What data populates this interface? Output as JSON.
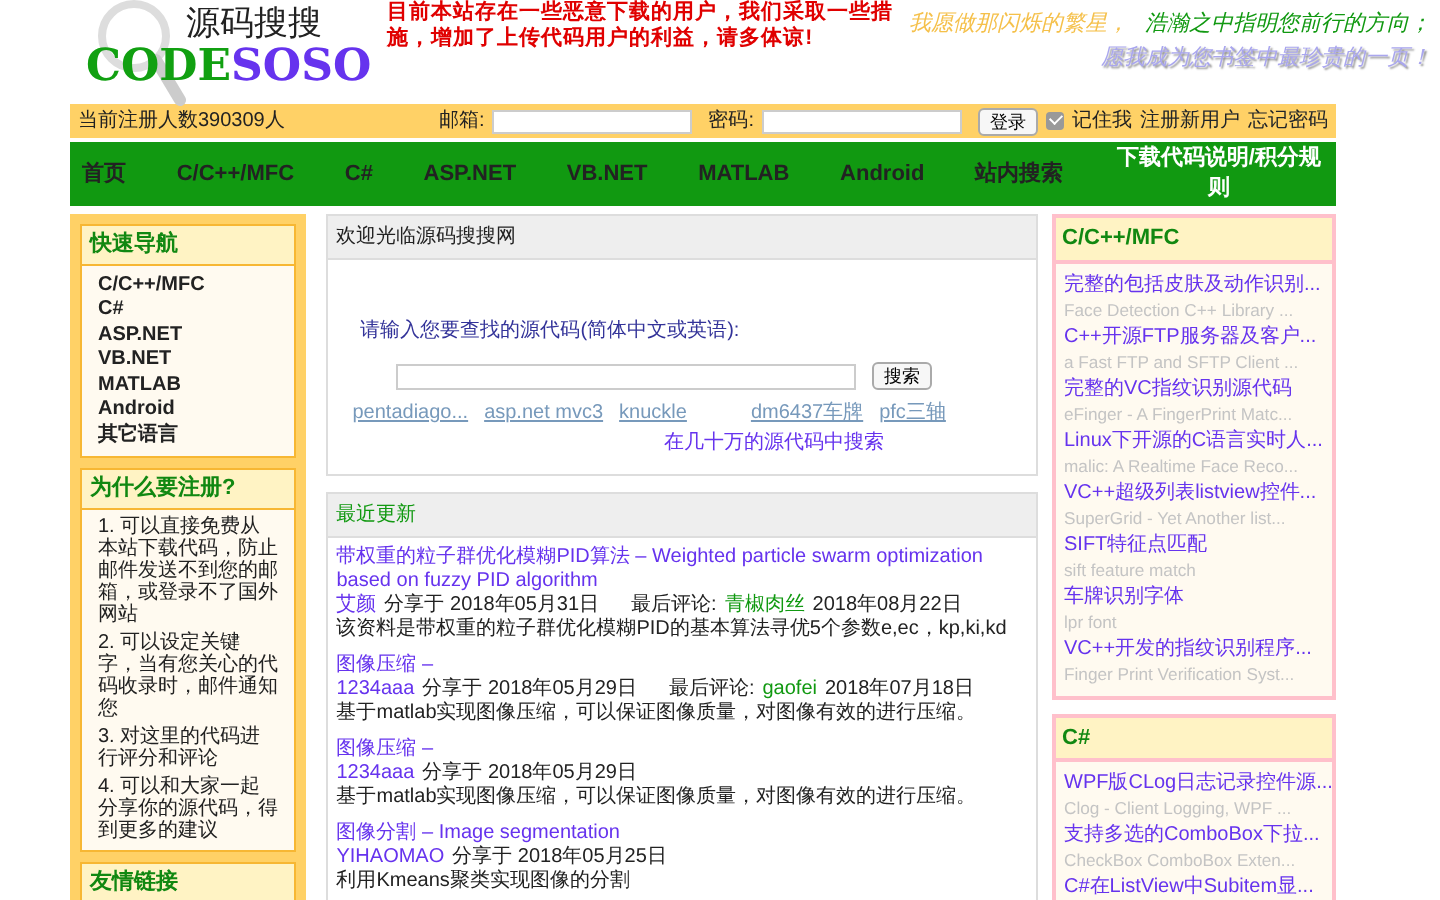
{
  "logo": {
    "chinese": "源码搜搜",
    "english_first": "CODE",
    "english_second": "SOSO"
  },
  "notice": "目前本站存在一些恶意下载的用户，我们采取一些措施，增加了上传代码用户的利益，请多体谅!",
  "slogans": [
    "我愿做那闪烁的繁星，",
    "浩瀚之中指明您前行的方向；",
    "愿我成为您书签中最珍贵的一页！"
  ],
  "login_bar": {
    "member_count": "当前注册人数390309人",
    "email_label": "邮箱:",
    "password_label": "密码:",
    "login_button": "登录",
    "remember": {
      "label": "记住我",
      "checked": true
    },
    "links": [
      "注册新用户",
      "忘记密码"
    ]
  },
  "nav": [
    "首页",
    "C/C++/MFC",
    "C#",
    "ASP.NET",
    "VB.NET",
    "MATLAB",
    "Android",
    "站内搜索",
    "下载代码说明/积分规则"
  ],
  "left_sidebar": {
    "quick_nav": {
      "title": "快速导航",
      "items": [
        "C/C++/MFC",
        "C#",
        "ASP.NET",
        "VB.NET",
        "MATLAB",
        "Android",
        "其它语言"
      ]
    },
    "why_register": {
      "title": "为什么要注册?",
      "points": [
        "1. 可以直接免费从本站下载代码，防止邮件发送不到您的邮箱，或登录不了国外网站",
        "2. 可以设定关键字，当有您关心的代码收录时，邮件通知您",
        "3. 对这里的代码进行评分和评论",
        "4. 可以和大家一起分享你的源代码，得到更多的建议"
      ]
    },
    "links": {
      "title": "友情链接"
    }
  },
  "welcome": {
    "title": "欢迎光临源码搜搜网",
    "prompt": "请输入您要查找的源代码(简体中文或英语):",
    "search_button": "搜索",
    "hot_keywords": [
      "pentadiago...",
      "asp.net mvc3",
      "knuckle",
      "dm6437车牌",
      "pfc三轴"
    ],
    "search_all_link": "在几十万的源代码中搜索"
  },
  "recent_updates": {
    "title": "最近更新",
    "entries": [
      {
        "title": "带权重的粒子群优化模糊PID算法 – Weighted particle swarm optimization based on fuzzy PID algorithm",
        "user": "艾颜",
        "shared": "分享于 2018年05月31日",
        "comment_label": "最后评论:",
        "commenter": "青椒肉丝",
        "comment_date": "2018年08月22日",
        "description": "该资料是带权重的粒子群优化模糊PID的基本算法寻优5个参数e,ec，kp,ki,kd"
      },
      {
        "title": "图像压缩 –",
        "user": "1234aaa",
        "shared": "分享于 2018年05月29日",
        "comment_label": "最后评论:",
        "commenter": "gaofei",
        "comment_date": "2018年07月18日",
        "description": "基于matlab实现图像压缩，可以保证图像质量，对图像有效的进行压缩。"
      },
      {
        "title": "图像压缩 –",
        "user": "1234aaa",
        "shared": "分享于 2018年05月29日",
        "description": "基于matlab实现图像压缩，可以保证图像质量，对图像有效的进行压缩。"
      },
      {
        "title": "图像分割 – Image segmentation",
        "user": "YIHAOMAO",
        "shared": "分享于 2018年05月25日",
        "description": "利用Kmeans聚类实现图像的分割"
      }
    ]
  },
  "right_sidebar": [
    {
      "title": "C/C++/MFC",
      "items": [
        {
          "kind": "title",
          "text": "完整的包括皮肤及动作识别..."
        },
        {
          "kind": "original",
          "text": "Face Detection C++ Library ..."
        },
        {
          "kind": "title",
          "text": "C++开源FTP服务器及客户..."
        },
        {
          "kind": "original",
          "text": "a Fast FTP and SFTP Client ..."
        },
        {
          "kind": "title",
          "text": "完整的VC指纹识别源代码"
        },
        {
          "kind": "original",
          "text": "eFinger - A FingerPrint Matc..."
        },
        {
          "kind": "title",
          "text": "Linux下开源的C语言实时人..."
        },
        {
          "kind": "original",
          "text": "malic: A Realtime Face Reco..."
        },
        {
          "kind": "title",
          "text": "VC++超级列表listview控件..."
        },
        {
          "kind": "original",
          "text": "SuperGrid - Yet Another list..."
        },
        {
          "kind": "title",
          "text": "SIFT特征点匹配"
        },
        {
          "kind": "original",
          "text": "sift feature match"
        },
        {
          "kind": "title",
          "text": "车牌识别字体"
        },
        {
          "kind": "original",
          "text": "lpr font"
        },
        {
          "kind": "title",
          "text": "VC++开发的指纹识别程序..."
        },
        {
          "kind": "original",
          "text": "Finger Print Verification Syst..."
        }
      ]
    },
    {
      "title": "C#",
      "items": [
        {
          "kind": "title",
          "text": "WPF版CLog日志记录控件源..."
        },
        {
          "kind": "original",
          "text": "Clog - Client Logging, WPF ..."
        },
        {
          "kind": "title",
          "text": "支持多选的ComboBox下拉..."
        },
        {
          "kind": "original",
          "text": "CheckBox ComboBox Exten..."
        },
        {
          "kind": "title",
          "text": "C#在ListView中Subitem显..."
        }
      ]
    }
  ]
}
